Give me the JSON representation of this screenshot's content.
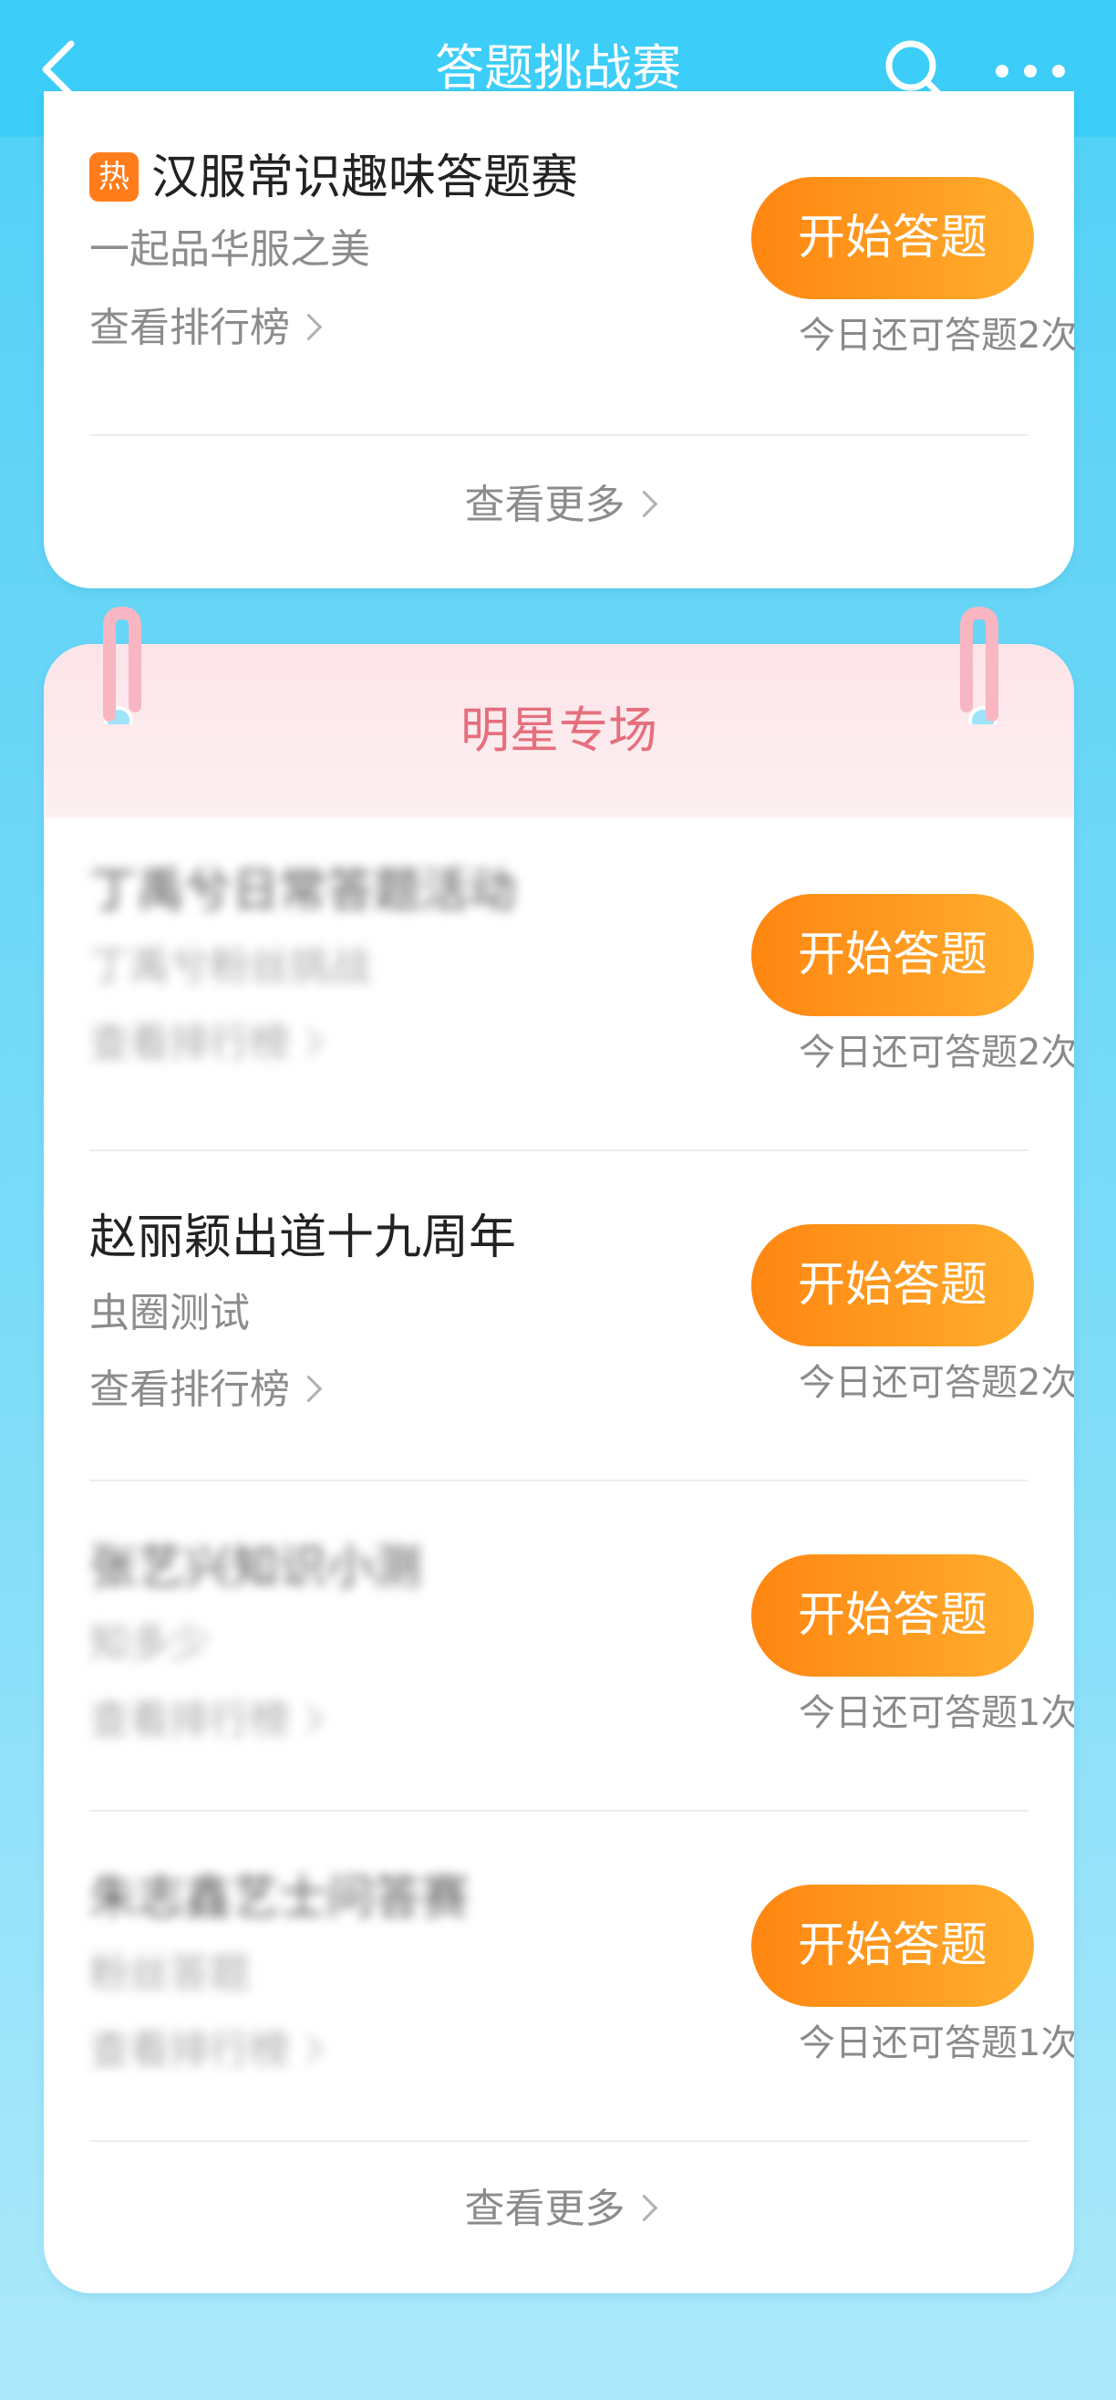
{
  "header": {
    "title": "答题挑战赛",
    "icons": [
      "back-icon",
      "search-icon",
      "more-icon"
    ]
  },
  "card1": {
    "item": {
      "badge": "热",
      "title": "汉服常识趣味答题赛",
      "subtitle": "一起品华服之美",
      "rank_link": "查看排行榜",
      "button": "开始答题",
      "remaining": "今日还可答题2次"
    },
    "more": "查看更多"
  },
  "card2": {
    "title": "明星专场",
    "items": [
      {
        "title": "丁禹兮日常答题活动",
        "subtitle": "丁禹兮粉丝挑战",
        "rank_link": "查看排行榜",
        "button": "开始答题",
        "remaining": "今日还可答题2次",
        "blurred": true
      },
      {
        "title": "赵丽颖出道十九周年",
        "subtitle": "虫圈测试",
        "rank_link": "查看排行榜",
        "button": "开始答题",
        "remaining": "今日还可答题2次",
        "blurred": false
      },
      {
        "title": "张艺兴知识小测",
        "subtitle": "知多少",
        "rank_link": "查看排行榜",
        "button": "开始答题",
        "remaining": "今日还可答题1次",
        "blurred": true
      },
      {
        "title": "朱志鑫艺士问答赛",
        "subtitle": "粉丝答题",
        "rank_link": "查看排行榜",
        "button": "开始答题",
        "remaining": "今日还可答题1次",
        "blurred": true
      }
    ],
    "more": "查看更多"
  },
  "colors": {
    "header_bg": "#3ccdf8",
    "button_start": "#ff8611",
    "button_end": "#ffae2e",
    "section_title": "#e56f7d",
    "hot_badge": "#ff7d1a"
  }
}
